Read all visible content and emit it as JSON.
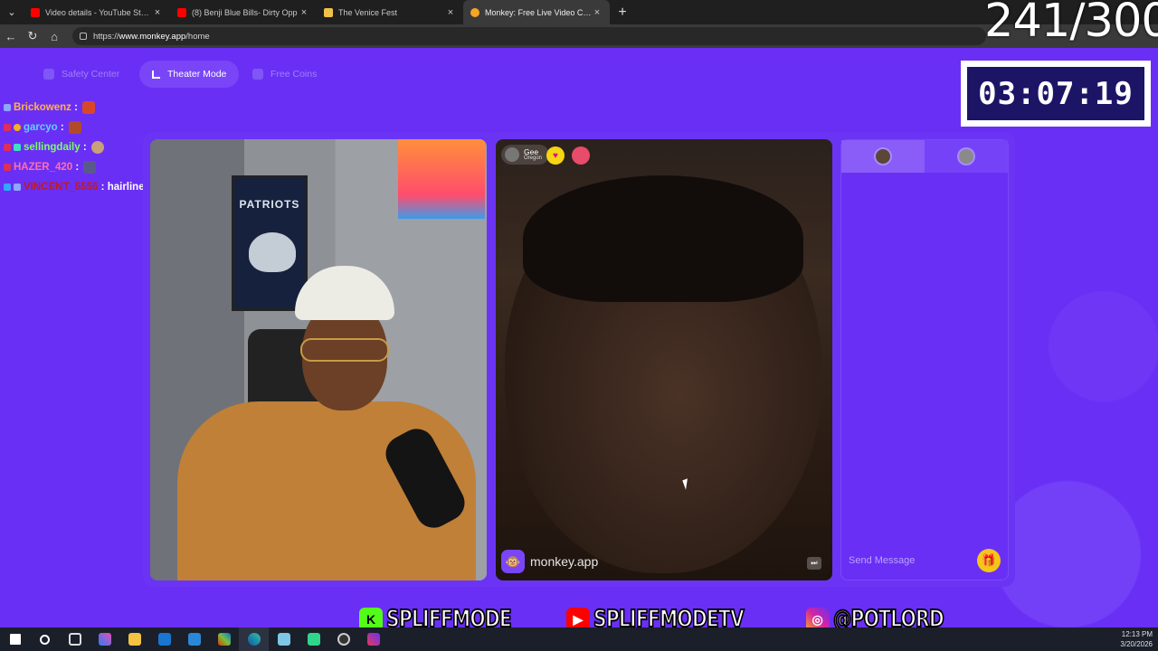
{
  "browser": {
    "tabs": [
      {
        "title": "Video details - YouTube Studio",
        "color": "#ff0000"
      },
      {
        "title": "(8) Benji Blue Bills- Dirty Opp",
        "color": "#ff0000"
      },
      {
        "title": "The Venice Fest",
        "color": "#f0c04a"
      },
      {
        "title": "Monkey: Free Live Video Chat",
        "color": "#f5a623"
      }
    ],
    "url_prefix": "https://",
    "url_host": "www.monkey.app",
    "url_path": "/home"
  },
  "topnav": {
    "safety": "Safety Center",
    "theater": "Theater Mode",
    "coins": "Free Coins"
  },
  "chat": [
    {
      "user": "Brickowenz",
      "color": "#ffb347",
      "text": ""
    },
    {
      "user": "garcyo",
      "color": "#5fd1ff",
      "text": ""
    },
    {
      "user": "sellingdaily",
      "color": "#7cfc6a",
      "text": ""
    },
    {
      "user": "HAZER_420",
      "color": "#ff6fa8",
      "text": ""
    },
    {
      "user": "VINCENT_5556",
      "color": "#c21a1a",
      "text": "hairline like a"
    }
  ],
  "video_left": {
    "poster_text": "PATRIOTS"
  },
  "video_right": {
    "peer_name": "Gee",
    "peer_location": "Oregon",
    "watermark": "monkey.app"
  },
  "sidepanel": {
    "message_placeholder": "Send Message"
  },
  "overlay": {
    "counter": "241/300",
    "timer": "03:07:19",
    "socials": [
      {
        "icon": "K",
        "color": "#53fc18",
        "text": "SPLIFFMODE"
      },
      {
        "icon": "▶",
        "color": "#ff0000",
        "text": "SPLIFFMODETV"
      },
      {
        "icon": "◎",
        "color": "#d6249f",
        "text": "@POTLORD"
      }
    ]
  },
  "taskbar": {
    "time": "12:13 PM",
    "date": "3/20/2026"
  }
}
